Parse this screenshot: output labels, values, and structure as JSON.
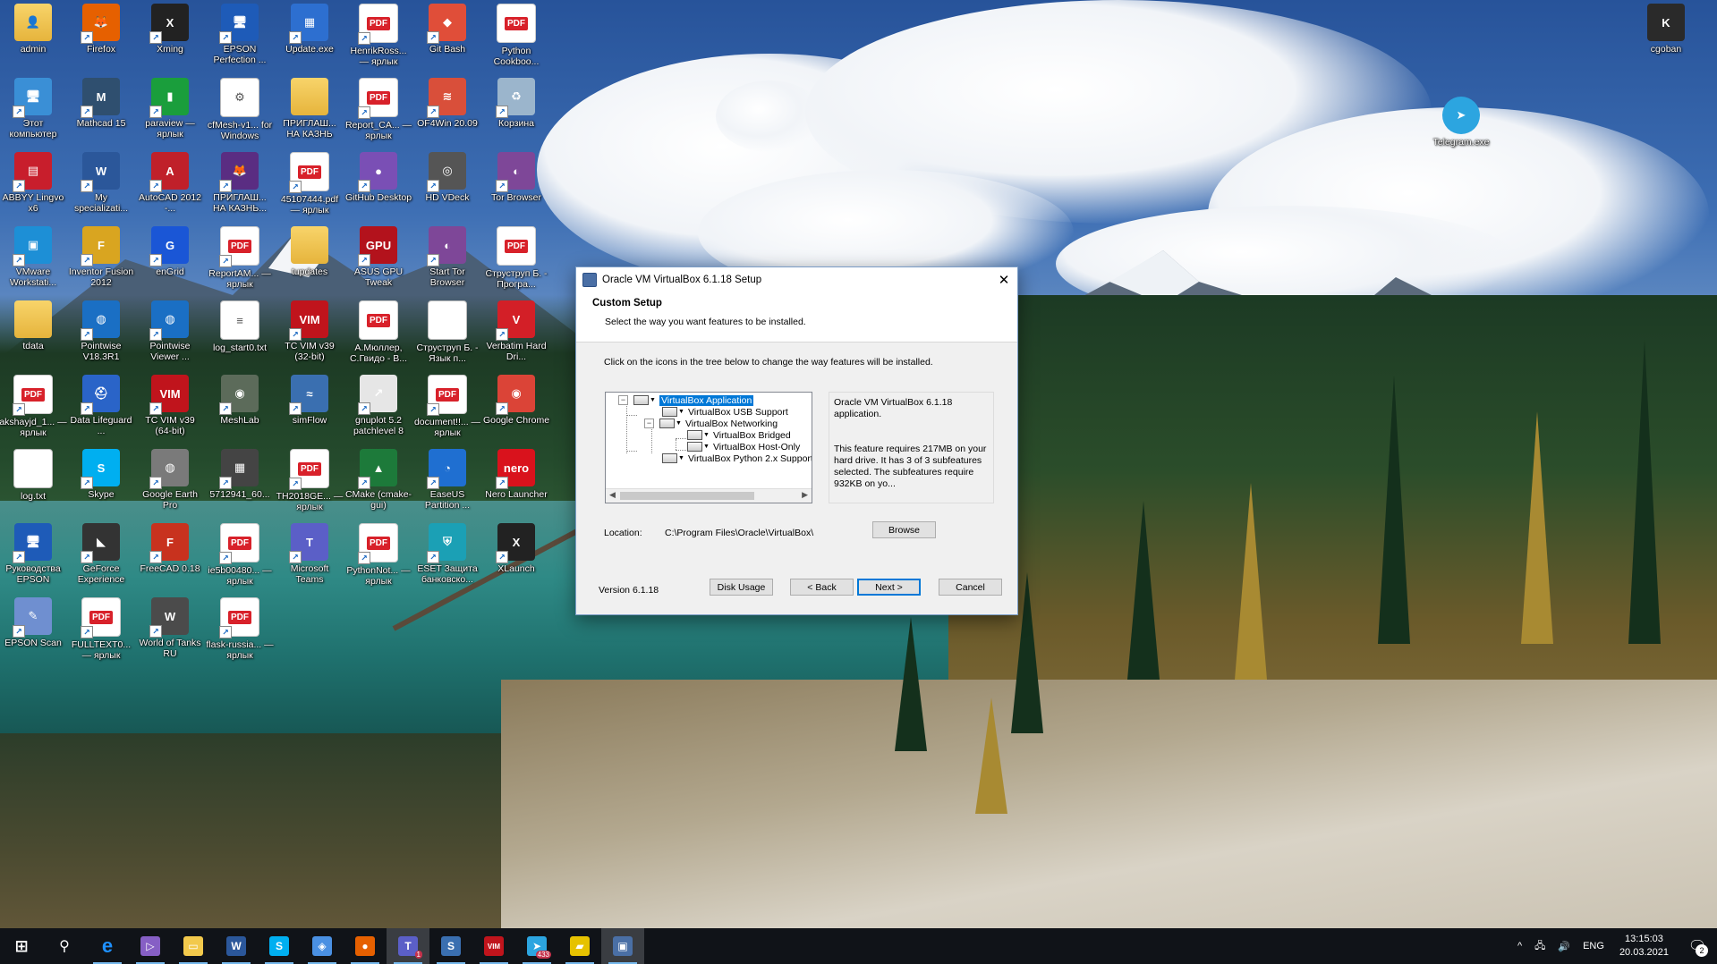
{
  "desktop": {
    "icons": [
      {
        "label": "admin",
        "glyph": "👤",
        "kind": "folder"
      },
      {
        "label": "Firefox",
        "glyph": "🦊",
        "kind": "app",
        "color": "#e66000"
      },
      {
        "label": "Xming",
        "glyph": "X",
        "kind": "app",
        "color": "#222222"
      },
      {
        "label": "EPSON Perfection ...",
        "glyph": "🖥",
        "kind": "app",
        "color": "#1e5bb8"
      },
      {
        "label": "Update.exe",
        "glyph": "▦",
        "kind": "app",
        "color": "#2d6fd0"
      },
      {
        "label": "HenrikRoss... — ярлык",
        "glyph": "PDF",
        "kind": "pdf"
      },
      {
        "label": "Git Bash",
        "glyph": "◆",
        "kind": "app",
        "color": "#e04e39"
      },
      {
        "label": "Python Cookboo...",
        "glyph": "PDF",
        "kind": "pdf"
      },
      {
        "label": "Этот компьютер",
        "glyph": "🖥",
        "kind": "app",
        "color": "#3a8fd6"
      },
      {
        "label": "Mathcad 15",
        "glyph": "M",
        "kind": "app",
        "color": "#2f4f6f"
      },
      {
        "label": "paraview — ярлык",
        "glyph": "▮",
        "kind": "app",
        "color": "#1a9e3c"
      },
      {
        "label": "cfMesh-v1... for Windows",
        "glyph": "⚙",
        "kind": "doc"
      },
      {
        "label": "ПРИГЛАШ... НА КАЗНЬ",
        "glyph": "",
        "kind": "folder"
      },
      {
        "label": "Report_CA... — ярлык",
        "glyph": "PDF",
        "kind": "pdf"
      },
      {
        "label": "OF4Win 20.09",
        "glyph": "≋",
        "kind": "app",
        "color": "#d94f3a"
      },
      {
        "label": "Корзина",
        "glyph": "♻",
        "kind": "app",
        "color": "#9bb5cc"
      },
      {
        "label": "ABBYY Lingvo x6",
        "glyph": "▤",
        "kind": "app",
        "color": "#c81e2c"
      },
      {
        "label": "My specializati...",
        "glyph": "W",
        "kind": "app",
        "color": "#2b579a"
      },
      {
        "label": "AutoCAD 2012 -...",
        "glyph": "A",
        "kind": "app",
        "color": "#c0202a"
      },
      {
        "label": "ПРИГЛАШ... НА КАЗНЬ...",
        "glyph": "🦊",
        "kind": "app",
        "color": "#5a2d82"
      },
      {
        "label": "45107444.pdf — ярлык",
        "glyph": "PDF",
        "kind": "pdf"
      },
      {
        "label": "GitHub Desktop",
        "glyph": "●",
        "kind": "app",
        "color": "#7a4fb5"
      },
      {
        "label": "HD VDeck",
        "glyph": "◎",
        "kind": "app",
        "color": "#555555"
      },
      {
        "label": "Tor Browser",
        "glyph": "◐",
        "kind": "app",
        "color": "#7e4798"
      },
      {
        "label": "VMware Workstati...",
        "glyph": "▣",
        "kind": "app",
        "color": "#1d8fd6"
      },
      {
        "label": "Inventor Fusion 2012",
        "glyph": "F",
        "kind": "app",
        "color": "#d9a520"
      },
      {
        "label": "enGrid",
        "glyph": "G",
        "kind": "app",
        "color": "#1a56d6"
      },
      {
        "label": "ReportAM... — ярлык",
        "glyph": "PDF",
        "kind": "pdf"
      },
      {
        "label": "tupdates",
        "glyph": "",
        "kind": "folder"
      },
      {
        "label": "ASUS GPU Tweak",
        "glyph": "GPU",
        "kind": "app",
        "color": "#b3121c"
      },
      {
        "label": "Start Tor Browser",
        "glyph": "◐",
        "kind": "app",
        "color": "#7e4798"
      },
      {
        "label": "Струструп Б. - Програ...",
        "glyph": "PDF",
        "kind": "pdf"
      },
      {
        "label": "tdata",
        "glyph": "",
        "kind": "folder"
      },
      {
        "label": "Pointwise V18.3R1",
        "glyph": "◍",
        "kind": "app",
        "color": "#1a6fc4"
      },
      {
        "label": "Pointwise Viewer ...",
        "glyph": "◍",
        "kind": "app",
        "color": "#1a6fc4"
      },
      {
        "label": "log_start0.txt",
        "glyph": "≡",
        "kind": "doc"
      },
      {
        "label": "TC VIM v39 (32-bit)",
        "glyph": "VIM",
        "kind": "app",
        "color": "#c0141c"
      },
      {
        "label": "А.Мюллер, С.Гвидо - В...",
        "glyph": "PDF",
        "kind": "pdf"
      },
      {
        "label": "Струструп Б. - Язык п...",
        "glyph": "",
        "kind": "doc"
      },
      {
        "label": "Verbatim Hard Dri...",
        "glyph": "V",
        "kind": "app",
        "color": "#d31f27"
      },
      {
        "label": "akshayjd_1... — ярлык",
        "glyph": "PDF",
        "kind": "pdf"
      },
      {
        "label": "Data Lifeguard ...",
        "glyph": "⛑",
        "kind": "app",
        "color": "#2a64c8"
      },
      {
        "label": "TC VIM v39 (64-bit)",
        "glyph": "VIM",
        "kind": "app",
        "color": "#c0141c"
      },
      {
        "label": "MeshLab",
        "glyph": "◉",
        "kind": "app",
        "color": "#5c6b5a"
      },
      {
        "label": "simFlow",
        "glyph": "≈",
        "kind": "app",
        "color": "#3a6fb0"
      },
      {
        "label": "gnuplot 5.2 patchlevel 8",
        "glyph": "↗",
        "kind": "app",
        "color": "#e6e6e6"
      },
      {
        "label": "document!!... — ярлык",
        "glyph": "PDF",
        "kind": "pdf"
      },
      {
        "label": "Google Chrome",
        "glyph": "◉",
        "kind": "app",
        "color": "#db4437"
      },
      {
        "label": "log.txt",
        "glyph": "",
        "kind": "doc"
      },
      {
        "label": "Skype",
        "glyph": "S",
        "kind": "app",
        "color": "#00aff0"
      },
      {
        "label": "Google Earth Pro",
        "glyph": "◍",
        "kind": "app",
        "color": "#7a7a7a"
      },
      {
        "label": "5712941_60...",
        "glyph": "▦",
        "kind": "app",
        "color": "#444444"
      },
      {
        "label": "TH2018GE... — ярлык",
        "glyph": "PDF",
        "kind": "pdf"
      },
      {
        "label": "CMake (cmake-gui)",
        "glyph": "▲",
        "kind": "app",
        "color": "#1d7a3a"
      },
      {
        "label": "EaseUS Partition ...",
        "glyph": "◔",
        "kind": "app",
        "color": "#1f6fd1"
      },
      {
        "label": "Nero Launcher",
        "glyph": "nero",
        "kind": "app",
        "color": "#d9121c"
      },
      {
        "label": "Руководства EPSON",
        "glyph": "🖥",
        "kind": "app",
        "color": "#1e5bb8"
      },
      {
        "label": "GeForce Experience",
        "glyph": "◣",
        "kind": "app",
        "color": "#333333"
      },
      {
        "label": "FreeCAD 0.18",
        "glyph": "F",
        "kind": "app",
        "color": "#c8321e"
      },
      {
        "label": "ie5b00480... — ярлык",
        "glyph": "PDF",
        "kind": "pdf"
      },
      {
        "label": "Microsoft Teams",
        "glyph": "T",
        "kind": "app",
        "color": "#5b5fc7"
      },
      {
        "label": "PythonNot... — ярлык",
        "glyph": "PDF",
        "kind": "pdf"
      },
      {
        "label": "ESET Защита банковско...",
        "glyph": "⛨",
        "kind": "app",
        "color": "#1ba0b5"
      },
      {
        "label": "XLaunch",
        "glyph": "X",
        "kind": "app",
        "color": "#222222"
      },
      {
        "label": "EPSON Scan",
        "glyph": "✎",
        "kind": "app",
        "color": "#6f8fd0"
      },
      {
        "label": "FULLTEXT0... — ярлык",
        "glyph": "PDF",
        "kind": "pdf"
      },
      {
        "label": "World of Tanks RU",
        "glyph": "W",
        "kind": "app",
        "color": "#4b4b4b"
      },
      {
        "label": "flask-russia... — ярлык",
        "glyph": "PDF",
        "kind": "pdf"
      }
    ],
    "right_icons": [
      {
        "label": "cgoban",
        "glyph": "K",
        "kind": "app",
        "color": "#2a2a2a"
      },
      {
        "label": "Telegram.exe",
        "glyph": "➤",
        "kind": "app",
        "color": "#2ca5e0"
      }
    ]
  },
  "dialog": {
    "title": "Oracle VM VirtualBox 6.1.18 Setup",
    "close_glyph": "✕",
    "heading": "Custom Setup",
    "subheading": "Select the way you want features to be installed.",
    "instructions": "Click on the icons in the tree below to change the way features will be installed.",
    "tree": [
      {
        "label": "VirtualBox Application",
        "selected": true
      },
      {
        "label": "VirtualBox USB Support",
        "selected": false
      },
      {
        "label": "VirtualBox Networking",
        "selected": false
      },
      {
        "label": "VirtualBox Bridged",
        "selected": false
      },
      {
        "label": "VirtualBox Host-Only",
        "selected": false
      },
      {
        "label": "VirtualBox Python 2.x Support",
        "selected": false
      }
    ],
    "description_1": "Oracle VM VirtualBox 6.1.18 application.",
    "description_2": "This feature requires 217MB on your hard drive. It has 3 of 3 subfeatures selected. The subfeatures require 932KB on yo...",
    "location_label": "Location:",
    "location_value": "C:\\Program Files\\Oracle\\VirtualBox\\",
    "browse_label": "Browse",
    "version": "Version 6.1.18",
    "disk_usage_label": "Disk Usage",
    "back_label": "< Back",
    "next_label": "Next >",
    "cancel_label": "Cancel"
  },
  "taskbar": {
    "items": [
      {
        "name": "start",
        "glyph": "⊞",
        "color": "#ffffff"
      },
      {
        "name": "search",
        "glyph": "⚲",
        "color": "#ffffff"
      },
      {
        "name": "edge",
        "glyph": "e",
        "color": "#1e90ff"
      },
      {
        "name": "visual-studio",
        "glyph": "▷",
        "color": "#865fc5"
      },
      {
        "name": "file-explorer",
        "glyph": "▭",
        "color": "#f2c94c"
      },
      {
        "name": "word",
        "glyph": "W",
        "color": "#2b579a"
      },
      {
        "name": "skype",
        "glyph": "S",
        "color": "#00aff0"
      },
      {
        "name": "epson",
        "glyph": "◈",
        "color": "#4a90e2"
      },
      {
        "name": "firefox",
        "glyph": "●",
        "color": "#e66000"
      },
      {
        "name": "teams",
        "glyph": "T",
        "color": "#5b5fc7"
      },
      {
        "name": "simflow",
        "glyph": "S",
        "color": "#3a6fb0"
      },
      {
        "name": "tc-vim",
        "glyph": "VIM",
        "color": "#c0141c"
      },
      {
        "name": "telegram",
        "glyph": "➤",
        "color": "#2ca5e0"
      },
      {
        "name": "drive-tool",
        "glyph": "▰",
        "color": "#e6c200"
      },
      {
        "name": "virtualbox-setup",
        "glyph": "▣",
        "color": "#4a6fa5"
      }
    ],
    "teams_badge": "1",
    "telegram_badge": "433",
    "tray_chevron": "^",
    "language": "ENG",
    "time": "13:15:03",
    "date": "20.03.2021",
    "notification_count": "2"
  }
}
